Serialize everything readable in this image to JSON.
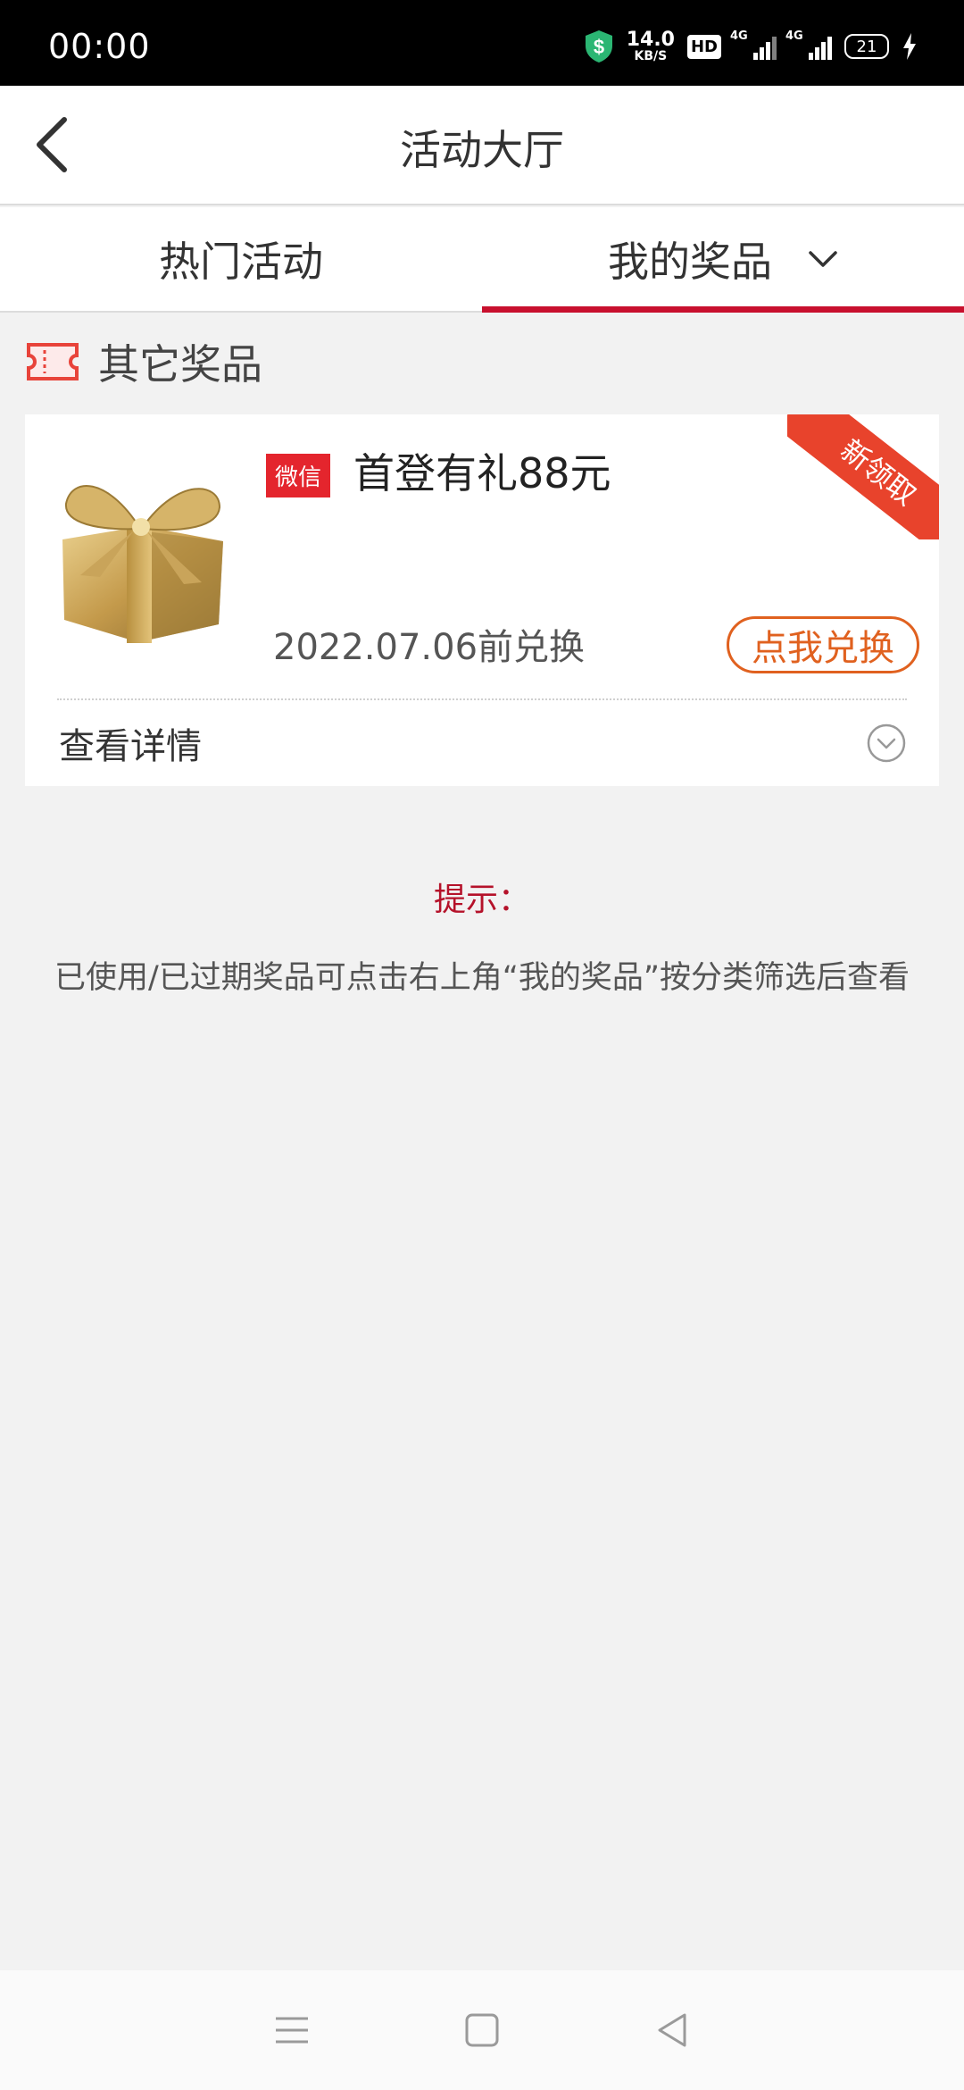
{
  "status_bar": {
    "time": "00:00",
    "net_speed_value": "14.0",
    "net_speed_unit": "KB/S",
    "hd_label": "HD",
    "signal1_label": "4G",
    "signal2_label": "4G",
    "battery": "21",
    "icons": [
      "shield-icon",
      "hd-icon",
      "signal-icon",
      "signal-icon",
      "battery-icon",
      "charging-icon"
    ]
  },
  "header": {
    "title": "活动大厅",
    "back_icon": "chevron-left-icon"
  },
  "tabs": [
    {
      "label": "热门活动",
      "active": false
    },
    {
      "label": "我的奖品",
      "active": true
    }
  ],
  "section": {
    "title": "其它奖品",
    "icon": "ticket-icon"
  },
  "prize_card": {
    "badge": "微信",
    "title": "首登有礼88元",
    "ribbon": "新领取",
    "expire": "2022.07.06前兑换",
    "redeem_label": "点我兑换",
    "detail_label": "查看详情",
    "image": "gift-box-icon"
  },
  "tip": {
    "title": "提示：",
    "text": "已使用/已过期奖品可点击右上角“我的奖品”按分类筛选后查看"
  },
  "navbar": {
    "icons": [
      "menu-icon",
      "home-square-icon",
      "back-triangle-icon"
    ]
  },
  "colors": {
    "accent_red": "#c8102e",
    "badge_red": "#e4252d",
    "ribbon": "#e8432c",
    "redeem_orange": "#e0611f",
    "tip_red": "#b5122a"
  }
}
